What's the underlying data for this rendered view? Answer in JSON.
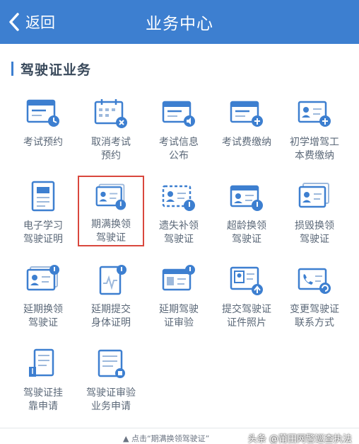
{
  "header": {
    "back_label": "返回",
    "title": "业务中心"
  },
  "section": {
    "title": "驾驶证业务"
  },
  "colors": {
    "header_bg": "#3d7fd0",
    "icon_blue": "#3d7fd0",
    "selected_border": "#d9473d"
  },
  "services": [
    {
      "line1": "考试预约",
      "line2": "",
      "icon": "form-clock-icon"
    },
    {
      "line1": "取消考试",
      "line2": "预约",
      "icon": "calendar-cancel-icon"
    },
    {
      "line1": "考试信息",
      "line2": "公布",
      "icon": "form-speaker-icon"
    },
    {
      "line1": "考试费缴纳",
      "line2": "",
      "icon": "form-fee-icon"
    },
    {
      "line1": "初学增驾工",
      "line2": "本费缴纳",
      "icon": "id-card-fee-icon"
    },
    {
      "line1": "电子学习",
      "line2": "驾驶证明",
      "icon": "document-stamp-icon"
    },
    {
      "line1": "期满换领",
      "line2": "驾驶证",
      "icon": "license-renew-icon",
      "selected": true
    },
    {
      "line1": "遗失补领",
      "line2": "驾驶证",
      "icon": "license-lost-icon"
    },
    {
      "line1": "超龄换领",
      "line2": "驾驶证",
      "icon": "license-age-icon"
    },
    {
      "line1": "损毁换领",
      "line2": "驾驶证",
      "icon": "license-damaged-icon"
    },
    {
      "line1": "延期换领",
      "line2": "驾驶证",
      "icon": "license-extend-icon"
    },
    {
      "line1": "延期提交",
      "line2": "身体证明",
      "icon": "health-report-icon"
    },
    {
      "line1": "延期驾驶",
      "line2": "证审验",
      "icon": "license-review-icon"
    },
    {
      "line1": "提交驾驶证",
      "line2": "证件照片",
      "icon": "photo-upload-icon"
    },
    {
      "line1": "变更驾驶证",
      "line2": "联系方式",
      "icon": "contact-change-icon"
    },
    {
      "line1": "驾驶证挂",
      "line2": "靠申请",
      "icon": "license-affiliate-icon"
    },
    {
      "line1": "驾驶证审验",
      "line2": "业务申请",
      "icon": "review-apply-icon"
    }
  ],
  "caption": {
    "note": "▲ 点击“期满换领驾驶证”",
    "credit": "头条 @莆田网警巡查执法"
  }
}
